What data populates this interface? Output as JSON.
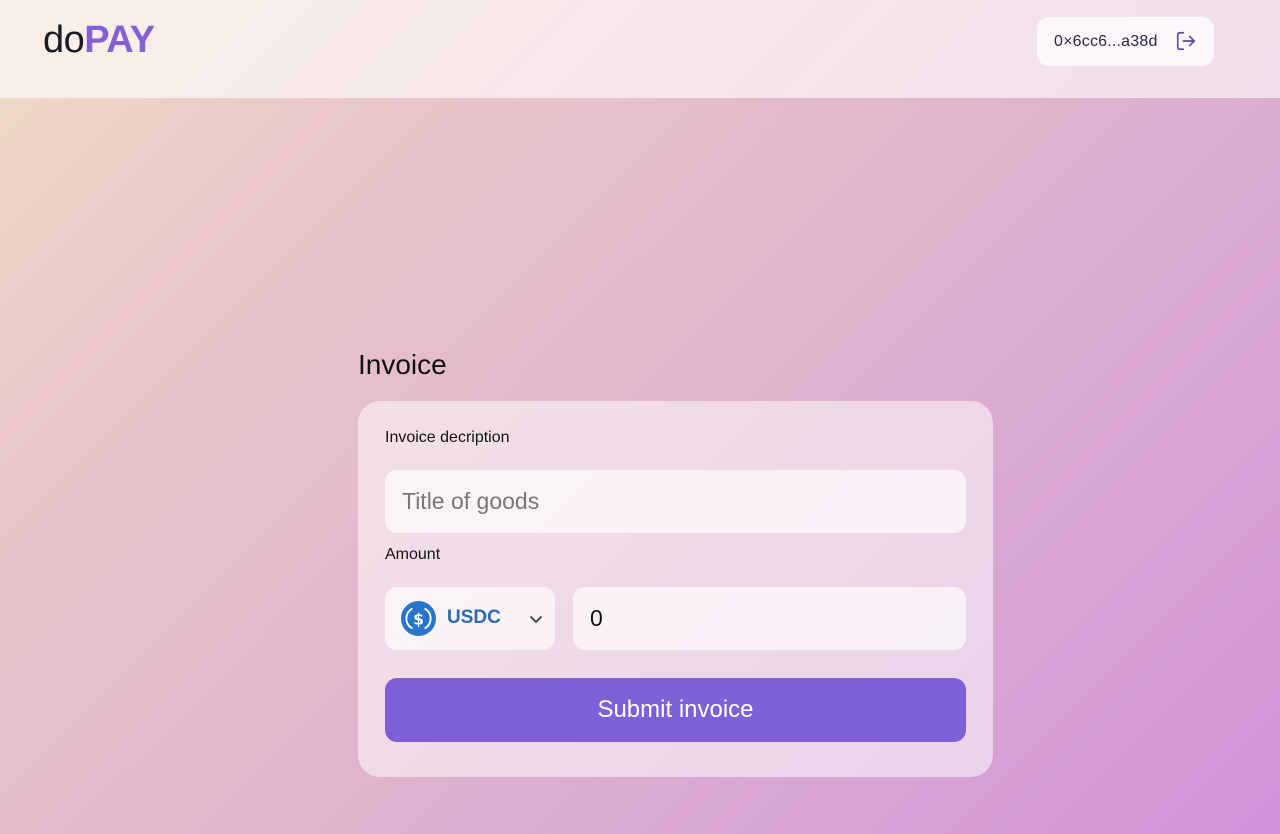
{
  "header": {
    "logo_prefix": "do",
    "logo_suffix": "PAY",
    "wallet_address": "0×6cc6...a38d",
    "logout_icon": "logout-icon"
  },
  "invoice": {
    "title": "Invoice",
    "description_label": "Invoice decription",
    "description_placeholder": "Title of goods",
    "description_value": "",
    "amount_label": "Amount",
    "token": {
      "symbol": "USDC",
      "icon": "usdc-icon",
      "color": "#2775ca"
    },
    "amount_value": "0",
    "submit_label": "Submit invoice"
  },
  "colors": {
    "brand": "#8560d4",
    "button": "#7f5fd8",
    "token_text": "#2b6bb1"
  }
}
